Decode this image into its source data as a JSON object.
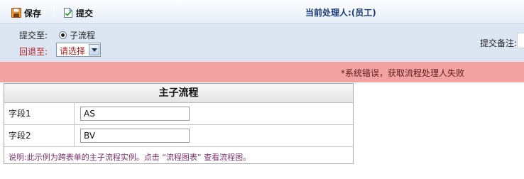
{
  "toolbar": {
    "save_label": "保存",
    "submit_label": "提交",
    "handler_text": "当前处理人:(员工)",
    "save_icon": "save-icon",
    "submit_icon": "submit-icon"
  },
  "submit_panel": {
    "submit_to_label": "提交至:",
    "subflow_option": "子流程",
    "subflow_selected": true,
    "return_to_label": "回退至:",
    "return_select_value": "请选择",
    "note_label": "提交备注:"
  },
  "error": {
    "message": "*系统错误，获取流程处理人失败"
  },
  "form": {
    "title": "主子流程",
    "rows": [
      {
        "label": "字段1",
        "value": "AS"
      },
      {
        "label": "字段2",
        "value": "BV"
      }
    ],
    "note": "说明:此示例为跨表单的主子流程实例。点击 “流程图表” 查看流程图。"
  },
  "colors": {
    "toolbar_bg": "#e6eef7",
    "panel_bg": "#dce6f3",
    "error_bg": "#f4a3a3",
    "return_label": "#b01a1a",
    "note_text": "#7a2e6a"
  }
}
